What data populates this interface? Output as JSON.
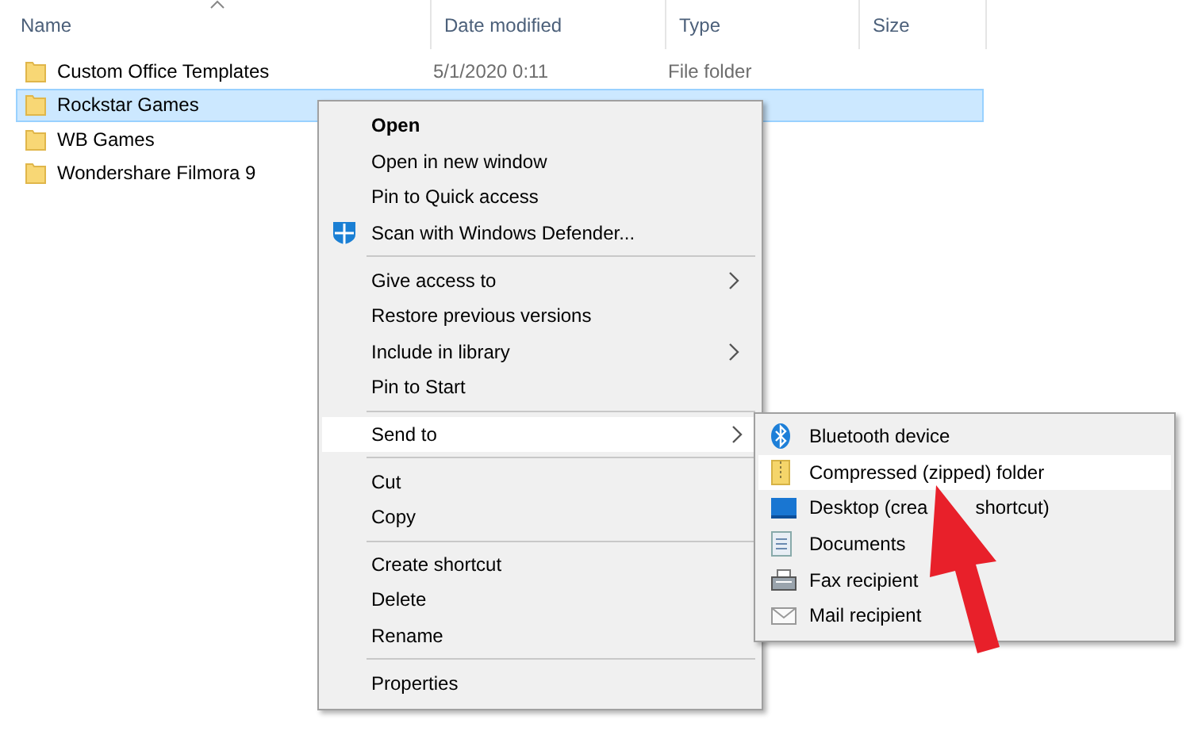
{
  "columns": [
    {
      "label": "Name",
      "sorted": true
    },
    {
      "label": "Date modified"
    },
    {
      "label": "Type"
    },
    {
      "label": "Size"
    }
  ],
  "files": [
    {
      "name": "Custom Office Templates",
      "date": "5/1/2020 0:11",
      "type": "File folder",
      "selected": false
    },
    {
      "name": "Rockstar Games",
      "selected": true
    },
    {
      "name": "WB Games",
      "selected": false
    },
    {
      "name": "Wondershare Filmora 9",
      "selected": false
    }
  ],
  "context_menu": {
    "items": [
      {
        "kind": "item",
        "label": "Open",
        "default": true,
        "has_submenu": false,
        "selected": false
      },
      {
        "kind": "item",
        "label": "Open in new window",
        "default": false,
        "has_submenu": false,
        "selected": false
      },
      {
        "kind": "item",
        "label": "Pin to Quick access",
        "default": false,
        "has_submenu": false,
        "selected": false
      },
      {
        "kind": "item",
        "label": "Scan with Windows Defender...",
        "default": false,
        "has_submenu": false,
        "selected": false
      },
      {
        "kind": "separator"
      },
      {
        "kind": "item",
        "label": "Give access to",
        "default": false,
        "has_submenu": true,
        "selected": false
      },
      {
        "kind": "item",
        "label": "Restore previous versions",
        "default": false,
        "has_submenu": false,
        "selected": false
      },
      {
        "kind": "item",
        "label": "Include in library",
        "default": false,
        "has_submenu": true,
        "selected": false
      },
      {
        "kind": "item",
        "label": "Pin to Start",
        "default": false,
        "has_submenu": false,
        "selected": false
      },
      {
        "kind": "separator"
      },
      {
        "kind": "item",
        "label": "Send to",
        "default": false,
        "has_submenu": true,
        "selected": true
      },
      {
        "kind": "separator"
      },
      {
        "kind": "item",
        "label": "Cut",
        "default": false,
        "has_submenu": false,
        "selected": false
      },
      {
        "kind": "item",
        "label": "Copy",
        "default": false,
        "has_submenu": false,
        "selected": false
      },
      {
        "kind": "separator"
      },
      {
        "kind": "item",
        "label": "Create shortcut",
        "default": false,
        "has_submenu": false,
        "selected": false
      },
      {
        "kind": "item",
        "label": "Delete",
        "default": false,
        "has_submenu": false,
        "selected": false
      },
      {
        "kind": "item",
        "label": "Rename",
        "default": false,
        "has_submenu": false,
        "selected": false
      },
      {
        "kind": "separator"
      },
      {
        "kind": "item",
        "label": "Properties",
        "default": false,
        "has_submenu": false,
        "selected": false
      }
    ]
  },
  "send_to_menu": {
    "items": [
      {
        "label": "Bluetooth device",
        "selected": false
      },
      {
        "label": "Compressed (zipped) folder",
        "selected": true
      },
      {
        "label": "Desktop (crea",
        "label_after_arrow": "shortcut)",
        "selected": false
      },
      {
        "label": "Documents",
        "selected": false
      },
      {
        "label": "Fax recipient",
        "selected": false
      },
      {
        "label": "Mail recipient",
        "selected": false
      }
    ]
  }
}
